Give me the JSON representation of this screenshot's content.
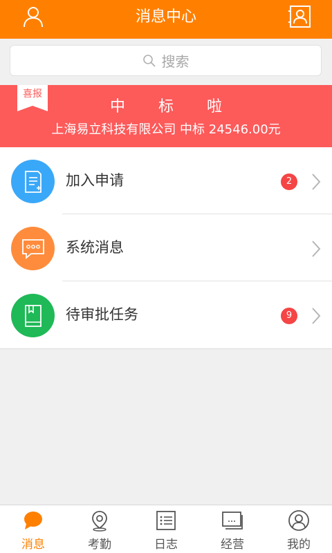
{
  "header": {
    "title": "消息中心"
  },
  "search": {
    "placeholder": "搜索"
  },
  "banner": {
    "ribbon": "喜报",
    "headline": "中标啦",
    "detail": "上海易立科技有限公司  中标  24546.00元"
  },
  "messages": [
    {
      "label": "加入申请",
      "badge": "2",
      "icon": "document-icon",
      "color": "#3aa8f8"
    },
    {
      "label": "系统消息",
      "badge": "",
      "icon": "chat-bubble-icon",
      "color": "#ff8c3c"
    },
    {
      "label": "待审批任务",
      "badge": "9",
      "icon": "book-icon",
      "color": "#1fb957"
    }
  ],
  "tabs": [
    {
      "label": "消息",
      "icon": "message-icon",
      "active": true
    },
    {
      "label": "考勤",
      "icon": "location-pin-icon",
      "active": false
    },
    {
      "label": "日志",
      "icon": "list-icon",
      "active": false
    },
    {
      "label": "经营",
      "icon": "cards-icon",
      "active": false
    },
    {
      "label": "我的",
      "icon": "profile-icon",
      "active": false
    }
  ],
  "colors": {
    "accent": "#ff8000",
    "banner": "#fd5a5a",
    "badge": "#f54545"
  }
}
